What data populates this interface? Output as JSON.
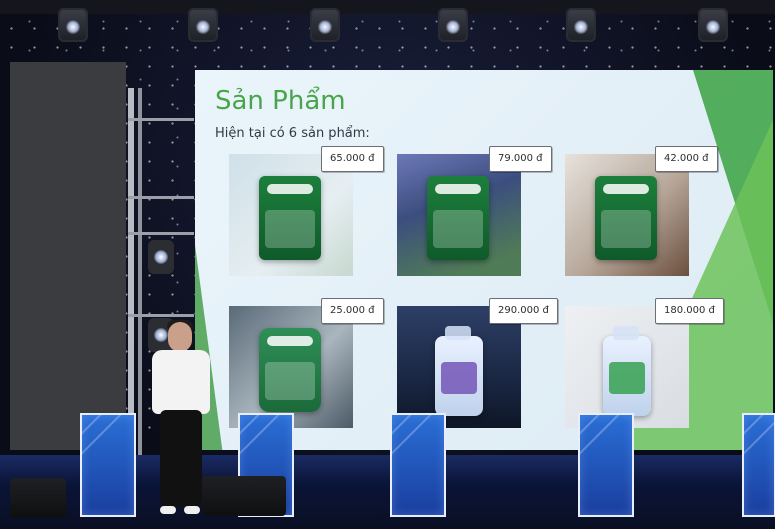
{
  "slide": {
    "title": "Sản Phẩm",
    "subtitle": "Hiện tại có 6 sản phẩm:",
    "products": [
      {
        "price": "65.000 đ"
      },
      {
        "price": "79.000 đ"
      },
      {
        "price": "42.000 đ"
      },
      {
        "price": "25.000 đ"
      },
      {
        "price": "290.000 đ"
      },
      {
        "price": "180.000 đ"
      }
    ]
  },
  "colors": {
    "slide_title": "#49a54b",
    "green_accent": "#43a54a",
    "stage_podium": "#2a6fd6"
  }
}
